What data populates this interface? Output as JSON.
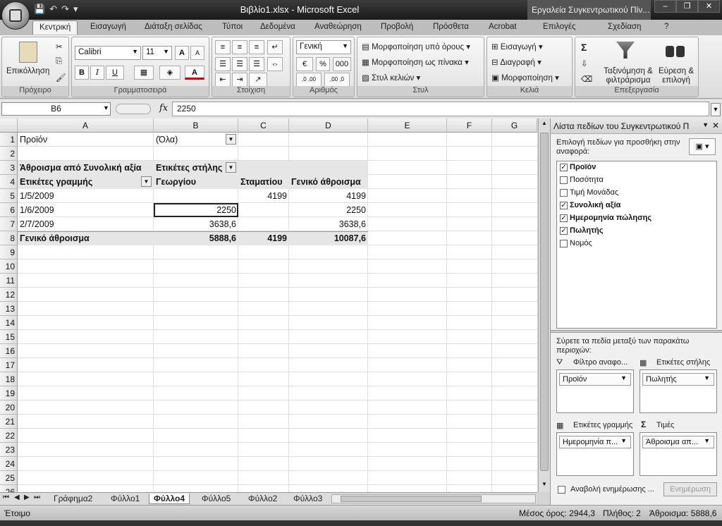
{
  "window": {
    "title": "Βιβλίο1.xlsx - Microsoft Excel",
    "tools_title": "Εργαλεία Συγκεντρωτικού Πίν...",
    "controls": [
      "–",
      "❐",
      "✕"
    ]
  },
  "tabs": [
    "Κεντρική",
    "Εισαγωγή",
    "Διάταξη σελίδας",
    "Τύποι",
    "Δεδομένα",
    "Αναθεώρηση",
    "Προβολή",
    "Πρόσθετα",
    "Acrobat",
    "Επιλογές",
    "Σχεδίαση"
  ],
  "ribbon": {
    "clipboard": {
      "label": "Πρόχειρο",
      "paste": "Επικόλληση"
    },
    "font": {
      "label": "Γραμματοσειρά",
      "family": "Calibri",
      "size": "11",
      "bold": "B",
      "italic": "I",
      "underline": "U",
      "grow": "A",
      "shrink": "A",
      "font_color": "A"
    },
    "alignment": {
      "label": "Στοίχιση"
    },
    "number": {
      "label": "Αριθμός",
      "format": "Γενική",
      "percent": "%",
      "thousands": "000",
      "dec_inc": ",0 ,00",
      "dec_dec": ",00 ,0"
    },
    "styles": {
      "label": "Στυλ",
      "conditional": "Μορφοποίηση υπό όρους",
      "as_table": "Μορφοποίηση ως πίνακα",
      "cell_styles": "Στυλ κελιών"
    },
    "cells": {
      "label": "Κελιά",
      "insert": "Εισαγωγή",
      "delete": "Διαγραφή",
      "format": "Μορφοποίηση"
    },
    "editing": {
      "label": "Επεξεργασία",
      "sum": "Σ",
      "sort": "Ταξινόμηση & φιλτράρισμα",
      "find": "Εύρεση & επιλογή"
    }
  },
  "formula_bar": {
    "name_box": "B6",
    "fx": "fx",
    "value": "2250"
  },
  "columns": [
    "A",
    "B",
    "C",
    "D",
    "E",
    "F",
    "G"
  ],
  "rows": [
    "1",
    "2",
    "3",
    "4",
    "5",
    "6",
    "7",
    "8",
    "9",
    "10",
    "11",
    "12",
    "13",
    "14",
    "15",
    "16",
    "17",
    "18",
    "19",
    "20",
    "21",
    "22",
    "23",
    "24",
    "25",
    "26"
  ],
  "pivot": {
    "filter_field": "Προϊόν",
    "filter_value": "(Όλα)",
    "values_caption": "Άθροισμα από Συνολική αξία",
    "col_labels": "Ετικέτες στήλης",
    "row_labels": "Ετικέτες γραμμής",
    "col_headers": [
      "Γεωργίου",
      "Σταματίου",
      "Γενικό άθροισμα"
    ],
    "rows": [
      {
        "label": "1/5/2009",
        "georgiou": "",
        "stamatiou": "4199",
        "total": "4199"
      },
      {
        "label": "1/6/2009",
        "georgiou": "2250",
        "stamatiou": "",
        "total": "2250"
      },
      {
        "label": "2/7/2009",
        "georgiou": "3638,6",
        "stamatiou": "",
        "total": "3638,6"
      }
    ],
    "grand_total": {
      "label": "Γενικό άθροισμα",
      "georgiou": "5888,6",
      "stamatiou": "4199",
      "total": "10087,6"
    }
  },
  "sheets": [
    "Γράφημα2",
    "Φύλλο1",
    "Φύλλο4",
    "Φύλλο5",
    "Φύλλο2",
    "Φύλλο3"
  ],
  "active_sheet": "Φύλλο4",
  "status": {
    "ready": "Έτοιμο",
    "average": "Μέσος όρος: 2944,3",
    "count": "Πλήθος: 2",
    "sum": "Άθροισμα: 5888,6"
  },
  "pane": {
    "title": "Λίστα πεδίων του Συγκεντρωτικού Π",
    "choose_text": "Επιλογή πεδίων για προσθήκη στην αναφορά:",
    "fields": [
      {
        "name": "Προϊόν",
        "checked": true
      },
      {
        "name": "Ποσότητα",
        "checked": false
      },
      {
        "name": "Τιμή Μονάδας",
        "checked": false
      },
      {
        "name": "Συνολική αξία",
        "checked": true
      },
      {
        "name": "Ημερομηνία πώλησης",
        "checked": true
      },
      {
        "name": "Πωλητής",
        "checked": true
      },
      {
        "name": "Νομός",
        "checked": false
      }
    ],
    "drag_text": "Σύρετε τα πεδία μεταξύ των παρακάτω περιοχών:",
    "report_filter": "Φίλτρο αναφο...",
    "column_labels": "Ετικέτες στήλης",
    "row_labels": "Ετικέτες γραμμής",
    "values": "Τιμές",
    "filter_chip": "Προϊόν",
    "column_chip": "Πωλητής",
    "row_chip": "Ημερομηνία π...",
    "values_chip": "Άθροισμα απ...",
    "defer": "Αναβολή ενημέρωσης ...",
    "update": "Ενημέρωση"
  }
}
